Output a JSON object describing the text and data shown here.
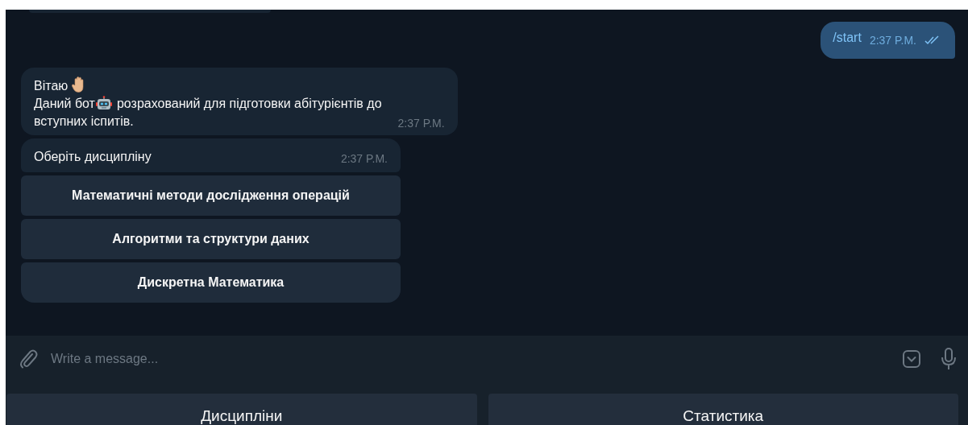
{
  "messages": [
    {
      "kind": "outgoing",
      "text": "/start",
      "time": "2:37 P.M.",
      "read": true
    },
    {
      "kind": "incoming",
      "lines": [
        [
          {
            "kind": "text",
            "text": "Вітаю"
          },
          {
            "kind": "hand"
          }
        ],
        [
          {
            "kind": "text",
            "text": "Даний бот"
          },
          {
            "kind": "robot"
          },
          {
            "kind": "text",
            "text": "розрахований для підготовки абітурієнтів до"
          }
        ],
        [
          {
            "kind": "text",
            "text": "вступних іспитів."
          }
        ]
      ],
      "time": "2:37 P.M."
    },
    {
      "kind": "incoming",
      "lines": [
        [
          {
            "kind": "text",
            "text": "Оберіть дисципліну"
          }
        ]
      ],
      "time": "2:37 P.M.",
      "inline_buttons": [
        "Математичні методи дослідження операцій",
        "Алгоритми та структури даних",
        "Дискретна Математика"
      ]
    }
  ],
  "composer": {
    "placeholder": "Write a message..."
  },
  "reply_keyboard": [
    "Дисципліни",
    "Статистика"
  ]
}
